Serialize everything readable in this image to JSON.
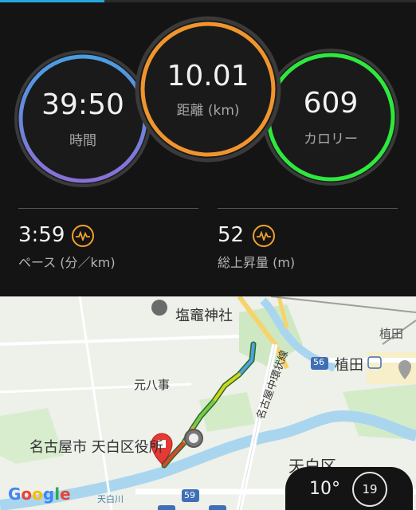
{
  "progress": {
    "fraction": 0.25,
    "color": "#2aa6df"
  },
  "circles": {
    "time": {
      "value": "39:50",
      "label": "時間",
      "ring_colors": [
        "#4a9ee0",
        "#8b6fd6"
      ]
    },
    "distance": {
      "value": "10.01",
      "label": "距離 (km)",
      "ring_color": "#f0952e"
    },
    "calories": {
      "value": "609",
      "label": "カロリー",
      "ring_color": "#2ee83d"
    }
  },
  "stats": {
    "pace": {
      "value": "3:59",
      "label": "ペース (分／km)",
      "icon": "pulse-icon"
    },
    "elevation": {
      "value": "52",
      "label": "総上昇量 (m)",
      "icon": "pulse-icon"
    }
  },
  "map": {
    "labels": {
      "shrine": "塩竈神社",
      "motohachiji": "元八事",
      "ueda_jp": "植田",
      "ueda_station": "植田",
      "road": "名古屋中環状線",
      "ward": "名古屋市 天白区役所",
      "tempaku": "天白区",
      "river": "天白川",
      "route_56": "56",
      "route_59": "59"
    },
    "brand": "Google"
  },
  "weather": {
    "temp": "10°",
    "badge": "19"
  }
}
